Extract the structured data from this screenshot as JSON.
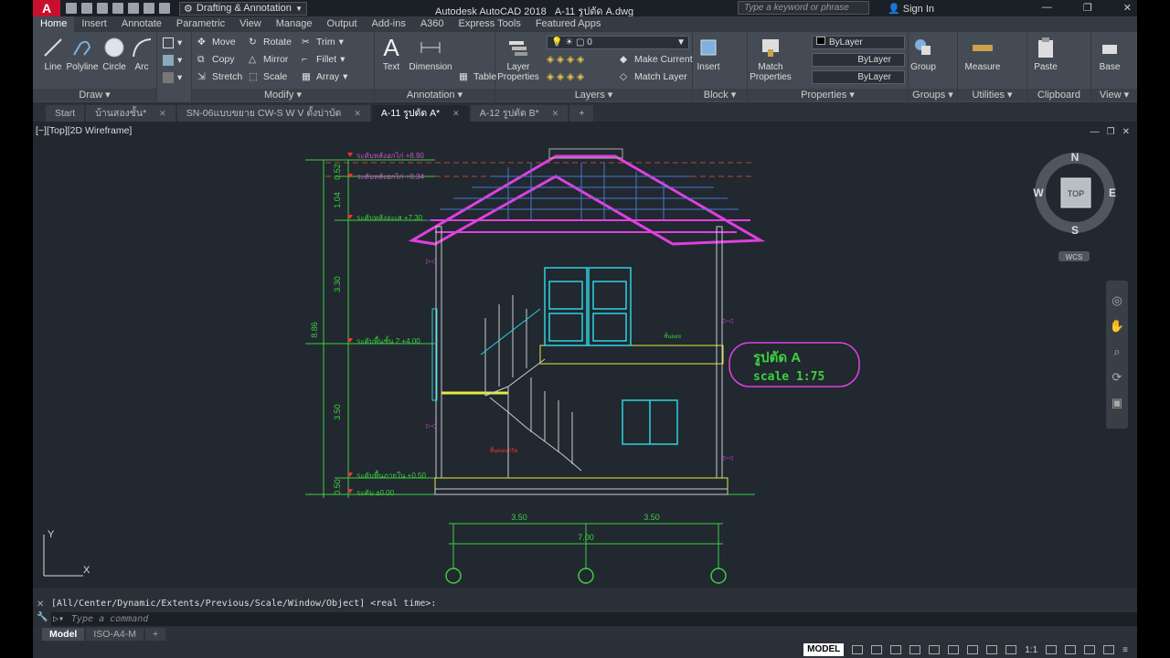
{
  "app": {
    "title": "Autodesk AutoCAD 2018",
    "document": "A-11 รูปตัด A.dwg",
    "logo": "A",
    "workspace": "Drafting & Annotation",
    "search_placeholder": "Type a keyword or phrase",
    "sign_in": "Sign In"
  },
  "ribbon_tabs": [
    "Home",
    "Insert",
    "Annotate",
    "Parametric",
    "View",
    "Manage",
    "Output",
    "Add-ins",
    "A360",
    "Express Tools",
    "Featured Apps"
  ],
  "ribbon": {
    "draw": {
      "title": "Draw",
      "tools": [
        "Line",
        "Polyline",
        "Circle",
        "Arc"
      ]
    },
    "modify": {
      "title": "Modify",
      "tools": [
        "Move",
        "Rotate",
        "Trim",
        "Copy",
        "Mirror",
        "Fillet",
        "Stretch",
        "Scale",
        "Array"
      ]
    },
    "annotation": {
      "title": "Annotation",
      "tools": [
        "Text",
        "Dimension",
        "Table"
      ]
    },
    "layers": {
      "title": "Layers",
      "current_layer": "0",
      "tools": [
        "Layer Properties",
        "Make Current",
        "Match Layer"
      ]
    },
    "block": {
      "title": "Block",
      "tools": [
        "Insert"
      ]
    },
    "properties": {
      "title": "Properties",
      "tools": [
        "Match Properties"
      ],
      "color": "ByLayer",
      "linetype": "ByLayer",
      "lineweight": "ByLayer"
    },
    "groups": {
      "title": "Groups",
      "tools": [
        "Group"
      ]
    },
    "utilities": {
      "title": "Utilities",
      "tools": [
        "Measure"
      ]
    },
    "clipboard": {
      "title": "Clipboard",
      "tools": [
        "Paste"
      ]
    },
    "view": {
      "title": "View",
      "tools": [
        "Base"
      ]
    }
  },
  "file_tabs": [
    "Start",
    "บ้านสองชั้น*",
    "SN-06แบบขยาย CW-S W V ตั้งบ่าบัด",
    "A-11 รูปตัด A*",
    "A-12 รูปตัด B*"
  ],
  "active_file_tab": 3,
  "viewport": {
    "label": "[−][Top][2D Wireframe]",
    "viewcube": {
      "n": "N",
      "s": "S",
      "e": "E",
      "w": "W",
      "face": "TOP",
      "ucs": "WCS"
    },
    "ucs_x": "X",
    "ucs_y": "Y"
  },
  "drawing": {
    "section_title": "รูปตัด    A",
    "scale_text": "scale    1:75",
    "levels": [
      {
        "label": "ระดับหลังอกไก่ +8.90"
      },
      {
        "label": "ระดับหลังอกไก่ +8.34"
      },
      {
        "label": "ระดับหลังอะเส +7.30"
      },
      {
        "label": "ระดับพื้นชั้น 2 +4.00"
      },
      {
        "label": "ระดับพื้นภายใน +0.50"
      },
      {
        "label": "ระดับ  ±0.00"
      }
    ],
    "vertical_dims": [
      "0.52",
      "1.04",
      "3.30",
      "3.50",
      "0.50"
    ],
    "total_height": "8.86",
    "horizontal_dims": [
      "3.50",
      "3.50"
    ],
    "total_width": "7.00",
    "note1": "ชั้นลอย",
    "note2": "พื้นคอนกรีต"
  },
  "command": {
    "history": "[All/Center/Dynamic/Extents/Previous/Scale/Window/Object] <real time>:",
    "placeholder": "Type a command"
  },
  "layout_tabs": [
    "Model",
    "ISO-A4-M"
  ],
  "status": {
    "space": "MODEL",
    "scale": "1:1"
  }
}
